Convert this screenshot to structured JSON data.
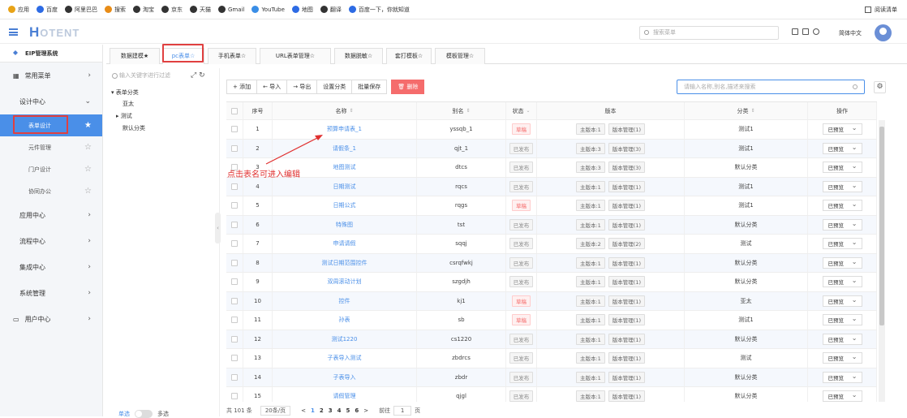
{
  "bookmarks": [
    {
      "label": "应用",
      "icon": "apps-icon",
      "color": "#e8a317"
    },
    {
      "label": "百度",
      "icon": "baidu-paw-icon",
      "color": "#2d6be4"
    },
    {
      "label": "阿里巴巴",
      "icon": "globe-icon",
      "color": "#333333"
    },
    {
      "label": "搜索",
      "icon": "search-o-icon",
      "color": "#e88c17"
    },
    {
      "label": "淘宝",
      "icon": "globe-icon",
      "color": "#333333"
    },
    {
      "label": "京东",
      "icon": "globe-icon",
      "color": "#333333"
    },
    {
      "label": "天猫",
      "icon": "globe-icon",
      "color": "#333333"
    },
    {
      "label": "Gmail",
      "icon": "globe-icon",
      "color": "#333333"
    },
    {
      "label": "YouTube",
      "icon": "tv-icon",
      "color": "#3a8ee6"
    },
    {
      "label": "地图",
      "icon": "map-icon",
      "color": "#2d6be4"
    },
    {
      "label": "翻译",
      "icon": "globe-icon",
      "color": "#333333"
    },
    {
      "label": "百度一下，你就知道",
      "icon": "baidu-paw-icon",
      "color": "#2d6be4"
    }
  ],
  "reading_list": "阅读清单",
  "header": {
    "logo_first": "H",
    "logo_rest": "OTENT",
    "search_placeholder": "搜索菜单",
    "language": "简体中文"
  },
  "sidebar": {
    "system_name": "EIP管理系统",
    "common_menu": "常用菜单",
    "design_center": "设计中心",
    "sub_items": [
      "表单设计",
      "元件管理",
      "门户设计",
      "协同办公"
    ],
    "groups": [
      "应用中心",
      "流程中心",
      "集成中心",
      "系统管理",
      "用户中心"
    ],
    "switch_left": "单选",
    "switch_right": "多选"
  },
  "tabs": [
    "数据建模★",
    "pc表单☆",
    "手机表单☆",
    "URL表单管理☆",
    "数据脱敏☆",
    "套打模板☆",
    "模板管理☆"
  ],
  "tree": {
    "filter_placeholder": "输入关键字进行过滤",
    "root": "表单分类",
    "children": [
      "亚太",
      "测试",
      "默认分类"
    ]
  },
  "toolbar": {
    "add": "+ 添加",
    "import": "← 导入",
    "export": "→ 导出",
    "set_category": "设置分类",
    "batch_save": "批量保存",
    "delete": "删除"
  },
  "filter_placeholder": "请输入名称,别名,描述来搜索",
  "columns": {
    "seq": "序号",
    "name": "名称",
    "alias": "别名",
    "status": "状态",
    "version": "版本",
    "category": "分类",
    "action": "操作"
  },
  "rows": [
    {
      "seq": "1",
      "name": "预算申请表_1",
      "alias": "yssqb_1",
      "status": "草稿",
      "draft": true,
      "main": "主版本:1",
      "mgr": "版本管理(1)",
      "category": "测试1",
      "op": "已预览"
    },
    {
      "seq": "2",
      "name": "请假条_1",
      "alias": "qjt_1",
      "status": "已发布",
      "draft": false,
      "main": "主版本:3",
      "mgr": "版本管理(3)",
      "category": "测试1",
      "op": "已预览"
    },
    {
      "seq": "3",
      "name": "地图测试",
      "alias": "dtcs",
      "status": "已发布",
      "draft": false,
      "main": "主版本:3",
      "mgr": "版本管理(3)",
      "category": "默认分类",
      "op": "已预览"
    },
    {
      "seq": "4",
      "name": "日期测试",
      "alias": "rqcs",
      "status": "已发布",
      "draft": false,
      "main": "主版本:1",
      "mgr": "版本管理(1)",
      "category": "测试1",
      "op": "已预览"
    },
    {
      "seq": "5",
      "name": "日期公式",
      "alias": "rqgs",
      "status": "草稿",
      "draft": true,
      "main": "主版本:1",
      "mgr": "版本管理(1)",
      "category": "测试1",
      "op": "已预览"
    },
    {
      "seq": "6",
      "name": "特殊图",
      "alias": "tst",
      "status": "已发布",
      "draft": false,
      "main": "主版本:1",
      "mgr": "版本管理(1)",
      "category": "默认分类",
      "op": "已预览"
    },
    {
      "seq": "7",
      "name": "申请请假",
      "alias": "sqqj",
      "status": "已发布",
      "draft": false,
      "main": "主版本:2",
      "mgr": "版本管理(2)",
      "category": "测试",
      "op": "已预览"
    },
    {
      "seq": "8",
      "name": "测试日期范围控件",
      "alias": "csrqfwkj",
      "status": "已发布",
      "draft": false,
      "main": "主版本:1",
      "mgr": "版本管理(1)",
      "category": "默认分类",
      "op": "已预览"
    },
    {
      "seq": "9",
      "name": "双周滚动计划",
      "alias": "szgdjh",
      "status": "已发布",
      "draft": false,
      "main": "主版本:1",
      "mgr": "版本管理(1)",
      "category": "默认分类",
      "op": "已预览"
    },
    {
      "seq": "10",
      "name": "控件",
      "alias": "kj1",
      "status": "草稿",
      "draft": true,
      "main": "主版本:1",
      "mgr": "版本管理(1)",
      "category": "亚太",
      "op": "已预览"
    },
    {
      "seq": "11",
      "name": "孙表",
      "alias": "sb",
      "status": "草稿",
      "draft": true,
      "main": "主版本:1",
      "mgr": "版本管理(1)",
      "category": "测试1",
      "op": "已预览"
    },
    {
      "seq": "12",
      "name": "测试1220",
      "alias": "cs1220",
      "status": "已发布",
      "draft": false,
      "main": "主版本:1",
      "mgr": "版本管理(1)",
      "category": "默认分类",
      "op": "已预览"
    },
    {
      "seq": "13",
      "name": "子表导入测试",
      "alias": "zbdrcs",
      "status": "已发布",
      "draft": false,
      "main": "主版本:1",
      "mgr": "版本管理(1)",
      "category": "测试",
      "op": "已预览"
    },
    {
      "seq": "14",
      "name": "子表导入",
      "alias": "zbdr",
      "status": "已发布",
      "draft": false,
      "main": "主版本:1",
      "mgr": "版本管理(1)",
      "category": "默认分类",
      "op": "已预览"
    },
    {
      "seq": "15",
      "name": "请假管理",
      "alias": "qjgl",
      "status": "已发布",
      "draft": false,
      "main": "主版本:1",
      "mgr": "版本管理(1)",
      "category": "默认分类",
      "op": "已预览"
    }
  ],
  "pager": {
    "total": "共 101 条",
    "page_size": "20条/页",
    "prev": "<",
    "pages": [
      "1",
      "2",
      "3",
      "4",
      "5",
      "6"
    ],
    "next": ">",
    "goto_label": "前往",
    "goto_value": "1",
    "page_unit": "页"
  },
  "annotation": "点击表名可进入编辑",
  "colors": {
    "accent": "#4a8fe8",
    "danger": "#f56c6c",
    "annotation": "#e03030"
  }
}
